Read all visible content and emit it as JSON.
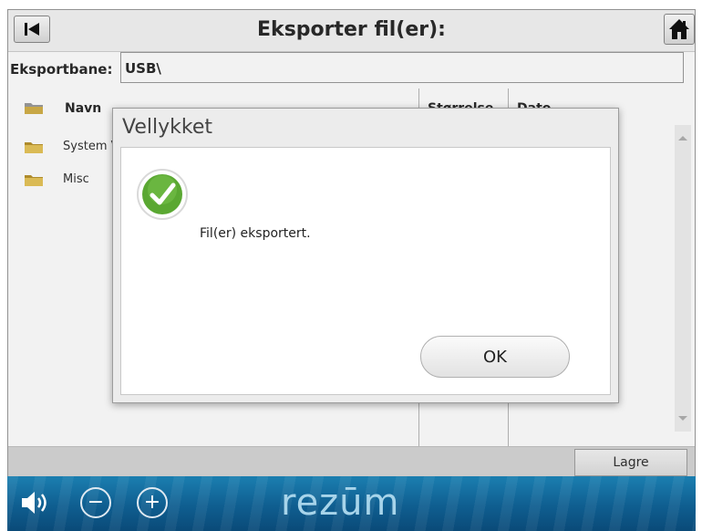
{
  "titlebar": {
    "title": "Eksporter fil(er):",
    "back_icon": "back-to-start-icon",
    "home_icon": "home-icon"
  },
  "export_path": {
    "label": "Eksportbane:",
    "value": "USB\\"
  },
  "file_list": {
    "columns": [
      "Navn",
      "Størrelse",
      "Dato"
    ],
    "rows": [
      {
        "name": "System Volume Information",
        "icon": "folder-icon"
      },
      {
        "name": "Misc",
        "icon": "folder-icon"
      }
    ]
  },
  "bottom_bar": {
    "save_label": "Lagre"
  },
  "dialog": {
    "title": "Vellykket",
    "message": "Fil(er) eksportert.",
    "ok_label": "OK",
    "icon": "success-check-icon"
  },
  "footer": {
    "brand": "rezūm",
    "volume_icon": "speaker-icon",
    "minus_label": "−",
    "plus_label": "+"
  },
  "colors": {
    "footer_blue": "#0f5e90",
    "success_green": "#5aa832"
  }
}
